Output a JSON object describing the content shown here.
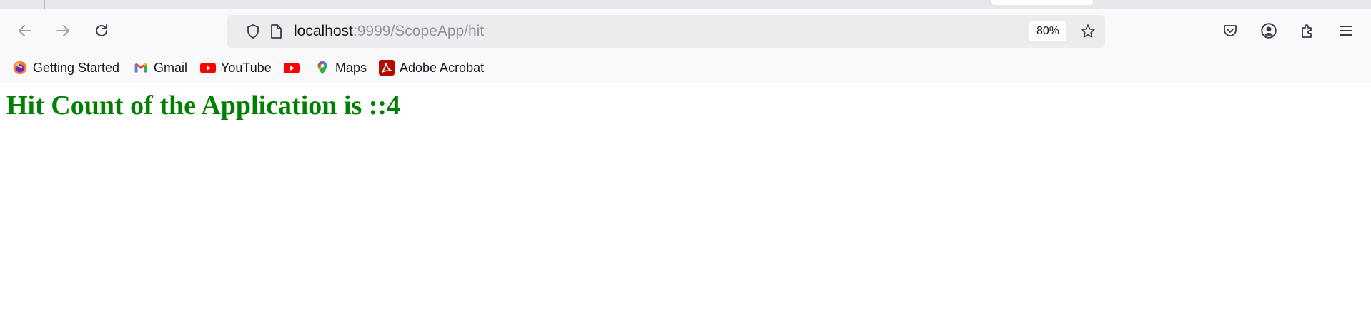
{
  "browser": {
    "nav": {
      "back_icon": "arrow-left-icon",
      "forward_icon": "arrow-right-icon",
      "reload_icon": "reload-icon"
    },
    "urlbar": {
      "host": "localhost",
      "path": ":9999/ScopeApp/hit",
      "zoom": "80%",
      "security_icon": "shield-icon",
      "page_icon": "page-icon",
      "bookmark_star_icon": "star-icon"
    },
    "toolbar_icons": [
      "pocket-icon",
      "account-icon",
      "extensions-icon",
      "menu-icon"
    ]
  },
  "bookmarks": [
    {
      "label": "Getting Started",
      "icon": "firefox-icon"
    },
    {
      "label": "Gmail",
      "icon": "gmail-icon"
    },
    {
      "label": "YouTube",
      "icon": "youtube-icon"
    },
    {
      "label": "",
      "icon": "youtube-icon"
    },
    {
      "label": "Maps",
      "icon": "maps-icon"
    },
    {
      "label": "Adobe Acrobat",
      "icon": "adobe-acrobat-icon"
    }
  ],
  "page": {
    "heading": "Hit Count of the Application is ::4",
    "heading_color": "#008000"
  },
  "colors": {
    "toolbar_bg": "#f9f9fb",
    "urlbar_bg": "#ececef",
    "youtube_red": "#ff0000",
    "acrobat_red": "#b30b00"
  }
}
